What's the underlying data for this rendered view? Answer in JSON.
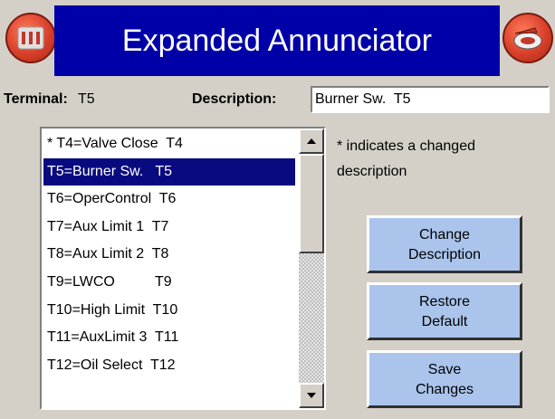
{
  "header": {
    "title": "Expanded Annunciator",
    "left_button_icon": "panel-icon",
    "right_button_icon": "back-icon",
    "title_bg": "#0000a8",
    "round_button_color": "#d8402a"
  },
  "terminal": {
    "label": "Terminal:",
    "value": "T5"
  },
  "description": {
    "label": "Description:",
    "value": "Burner Sw.  T5"
  },
  "list": {
    "items": [
      "* T4=Valve Close  T4",
      "T5=Burner Sw.   T5",
      "T6=OperControl  T6",
      "T7=Aux Limit 1  T7",
      "T8=Aux Limit 2  T8",
      "T9=LWCO          T9",
      "T10=High Limit  T10",
      "T11=AuxLimit 3  T11",
      "T12=Oil Select  T12"
    ],
    "selected_index": 1,
    "selected_color": "#0a0a80"
  },
  "note": "* indicates a changed description",
  "buttons": {
    "change": "Change\nDescription",
    "restore": "Restore\nDefault",
    "save": "Save\nChanges",
    "color": "#aac4ec"
  }
}
